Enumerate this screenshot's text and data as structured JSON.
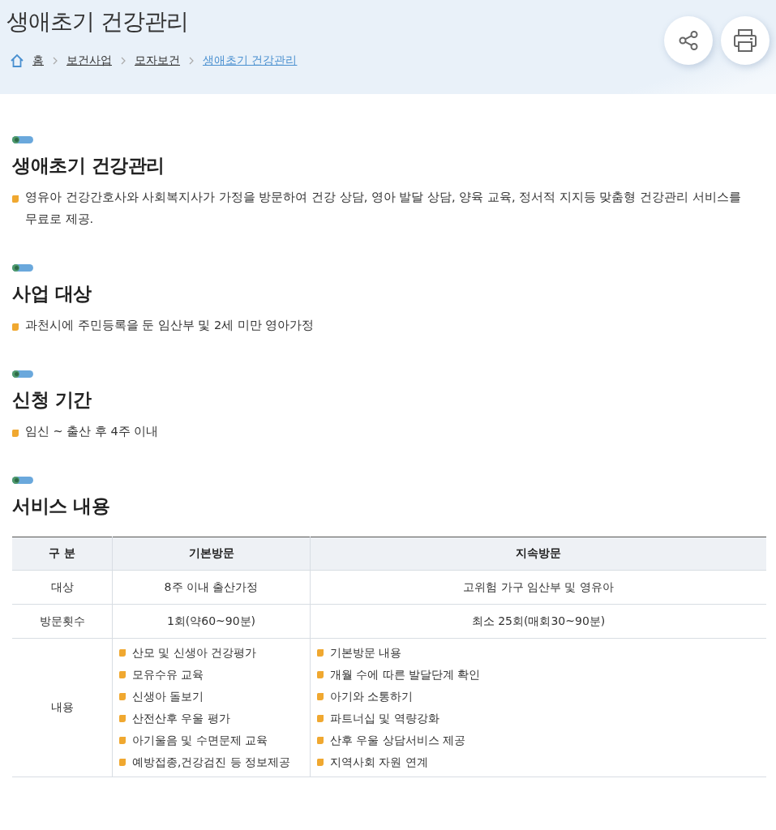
{
  "header": {
    "title": "생애초기 건강관리",
    "breadcrumb": [
      {
        "label": "홈",
        "current": false
      },
      {
        "label": "보건사업",
        "current": false
      },
      {
        "label": "모자보건",
        "current": false
      },
      {
        "label": "생애초기 건강관리",
        "current": true
      }
    ]
  },
  "sections": [
    {
      "heading": "생애초기 건강관리",
      "bullets": [
        "영유아 건강간호사와 사회복지사가 가정을 방문하여 건강 상담, 영아 발달 상담, 양육 교육, 정서적 지지등 맞춤형 건강관리 서비스를 무료로 제공."
      ]
    },
    {
      "heading": "사업 대상",
      "bullets": [
        "과천시에 주민등록을 둔 임산부 및 2세 미만 영아가정"
      ]
    },
    {
      "heading": "신청 기간",
      "bullets": [
        "임신 ~ 출산 후 4주 이내"
      ]
    },
    {
      "heading": "서비스 내용",
      "table": {
        "columns": [
          "구 분",
          "기본방문",
          "지속방문"
        ],
        "rows": [
          {
            "cells": [
              {
                "kind": "text",
                "text": "대상"
              },
              {
                "kind": "text",
                "text": "8주 이내 출산가정"
              },
              {
                "kind": "text",
                "text": "고위험 가구 임산부 및 영유아"
              }
            ]
          },
          {
            "cells": [
              {
                "kind": "text",
                "text": "방문횟수"
              },
              {
                "kind": "text",
                "text": "1회(약60~90분)"
              },
              {
                "kind": "text",
                "text": "최소 25회(매회30~90분)"
              }
            ]
          },
          {
            "cells": [
              {
                "kind": "text",
                "text": "내용"
              },
              {
                "kind": "list",
                "items": [
                  "산모 및 신생아 건강평가",
                  "모유수유 교육",
                  "신생아 돌보기",
                  "산전산후 우울 평가",
                  "아기울음 및 수면문제 교육",
                  "예방접종,건강검진 등 정보제공"
                ]
              },
              {
                "kind": "list",
                "items": [
                  "기본방문 내용",
                  "개월 수에 따른 발달단계 확인",
                  "아기와 소통하기",
                  "파트너십 및 역량강화",
                  "산후 우울 상담서비스 제공",
                  "지역사회 자원 연계"
                ]
              }
            ]
          }
        ]
      }
    }
  ]
}
